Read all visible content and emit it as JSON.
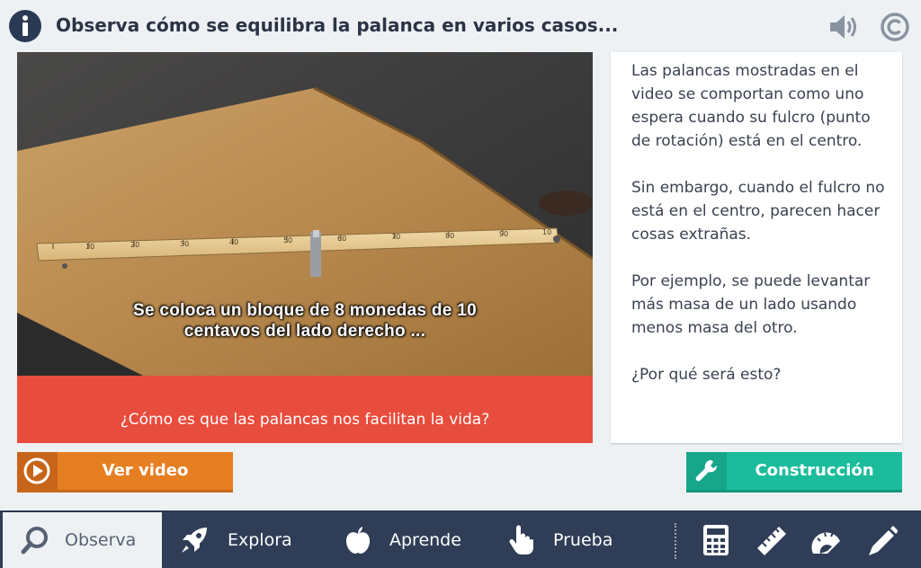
{
  "header": {
    "title": "Observa cómo se equilibra la palanca en varios casos...",
    "icons": [
      "info-icon",
      "speaker-icon",
      "copyright-icon"
    ]
  },
  "video": {
    "subtitle_lines": [
      "Se coloca un bloque de 8 monedas de 10",
      "centavos del lado derecho ..."
    ],
    "ruler_numbers": [
      "10",
      "20",
      "30",
      "40",
      "50",
      "60",
      "70",
      "80",
      "90",
      "10"
    ]
  },
  "question": {
    "text": "¿Cómo es que las palancas nos facilitan la vida?"
  },
  "panel": {
    "paragraphs": [
      "Las palancas mostradas en el video se comportan como uno espera cuando su fulcro (punto de rotación) está en el centro.",
      "Sin embargo, cuando el fulcro no está en el centro, parecen hacer cosas extrañas.",
      "Por ejemplo, se puede levantar más masa de un lado usando menos masa del otro.",
      "¿Por qué será esto?"
    ]
  },
  "buttons": {
    "video": {
      "label": "Ver video",
      "icon": "play-icon"
    },
    "build": {
      "label": "Construcción",
      "icon": "wrench-icon"
    }
  },
  "nav": {
    "items": [
      {
        "label": "Observa",
        "icon": "magnifier-icon",
        "active": true
      },
      {
        "label": "Explora",
        "icon": "rocket-icon",
        "active": false
      },
      {
        "label": "Aprende",
        "icon": "apple-icon",
        "active": false
      },
      {
        "label": "Prueba",
        "icon": "hand-pointer-icon",
        "active": false
      }
    ],
    "tools": [
      "calculator-icon",
      "ruler-icon",
      "protractor-icon",
      "pencil-icon"
    ]
  },
  "colors": {
    "question_bar": "#e84c3d",
    "video_button": "#e67e22",
    "build_button": "#1abc9c",
    "nav_background": "#2f3d57",
    "page_background": "#eef1f4"
  }
}
